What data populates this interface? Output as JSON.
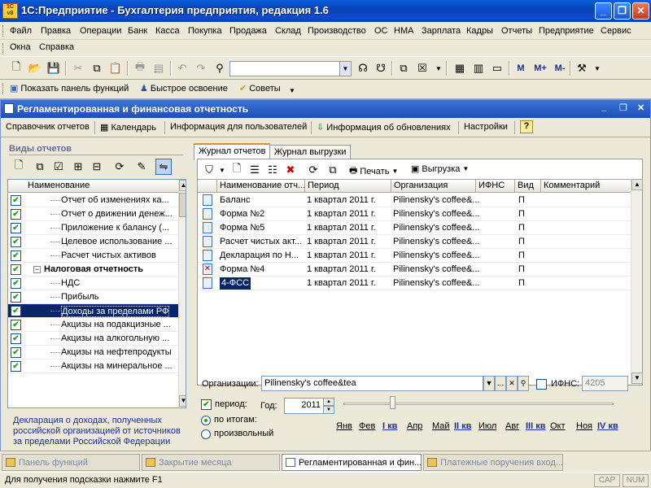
{
  "window": {
    "title": "1С:Предприятие - Бухгалтерия предприятия, редакция 1.6",
    "icon_text": "1С v8"
  },
  "menu": {
    "row1": [
      "Файл",
      "Правка",
      "Операции",
      "Банк",
      "Касса",
      "Покупка",
      "Продажа",
      "Склад",
      "Производство",
      "ОС",
      "НМА",
      "Зарплата",
      "Кадры",
      "Отчеты",
      "Предприятие",
      "Сервис"
    ],
    "row2": [
      "Окна",
      "Справка"
    ]
  },
  "toolbar": {
    "search_value": "",
    "m_buttons": [
      "M",
      "M+",
      "M-"
    ]
  },
  "toolbar2": {
    "functions_panel": "Показать панель функций",
    "quick_start": "Быстрое освоение",
    "tips": "Советы"
  },
  "doc": {
    "title": "Регламентированная и финансовая отчетность",
    "bar": {
      "reference": "Справочник отчетов",
      "calendar": "Календарь",
      "user_info": "Информация для пользователей",
      "updates": "Информация об обновлениях",
      "settings": "Настройки",
      "help": "?"
    }
  },
  "left": {
    "header": "Виды отчетов",
    "column": "Наименование",
    "rows": [
      {
        "label": "Отчет об изменениях ка...",
        "checked": true,
        "group": false
      },
      {
        "label": "Отчет о движении денеж...",
        "checked": true,
        "group": false
      },
      {
        "label": "Приложение к балансу (...",
        "checked": true,
        "group": false
      },
      {
        "label": "Целевое использование ...",
        "checked": true,
        "group": false
      },
      {
        "label": "Расчет чистых активов",
        "checked": true,
        "group": false
      },
      {
        "label": "Налоговая отчетность",
        "checked": true,
        "group": true
      },
      {
        "label": "НДС",
        "checked": true,
        "group": false
      },
      {
        "label": "Прибыль",
        "checked": true,
        "group": false
      },
      {
        "label": "Доходы за пределами РФ",
        "checked": true,
        "group": false,
        "selected": true
      },
      {
        "label": "Акцизы на подакцизные ...",
        "checked": true,
        "group": false
      },
      {
        "label": "Акцизы на алкогольную ...",
        "checked": true,
        "group": false
      },
      {
        "label": "Акцизы на нефтепродукты",
        "checked": true,
        "group": false
      },
      {
        "label": "Акцизы на минеральное ...",
        "checked": true,
        "group": false
      }
    ],
    "note": "Декларация о доходах, полученных российской организацией от источников за пределами Российской Федерации"
  },
  "right": {
    "tabs": [
      "Журнал отчетов",
      "Журнал выгрузки"
    ],
    "print": "Печать",
    "export": "Выгрузка",
    "columns": [
      "Наименование отч...",
      "Период",
      "Организация",
      "ИФНС",
      "Вид",
      "Комментарий"
    ],
    "rows": [
      {
        "name": "Баланс",
        "period": "1 квартал 2011 г.",
        "org": "Pilinensky's coffee&...",
        "ifns": "",
        "kind": "П",
        "comment": ""
      },
      {
        "name": "Форма №2",
        "period": "1 квартал 2011 г.",
        "org": "Pilinensky's coffee&...",
        "ifns": "",
        "kind": "П",
        "comment": ""
      },
      {
        "name": "Форма №5",
        "period": "1 квартал 2011 г.",
        "org": "Pilinensky's coffee&...",
        "ifns": "",
        "kind": "П",
        "comment": ""
      },
      {
        "name": "Расчет чистых акт...",
        "period": "1 квартал 2011 г.",
        "org": "Pilinensky's coffee&...",
        "ifns": "",
        "kind": "П",
        "comment": ""
      },
      {
        "name": "Декларация по Н...",
        "period": "1 квартал 2011 г.",
        "org": "Pilinensky's coffee&...",
        "ifns": "",
        "kind": "П",
        "comment": ""
      },
      {
        "name": "Форма №4",
        "period": "1 квартал 2011 г.",
        "org": "Pilinensky's coffee&...",
        "ifns": "",
        "kind": "П",
        "comment": "",
        "deleted": true
      },
      {
        "name": "4-ФСС",
        "period": "1 квартал 2011 г.",
        "org": "Pilinensky's coffee&...",
        "ifns": "",
        "kind": "П",
        "comment": "",
        "selected": true
      }
    ],
    "org_label": "Организации:",
    "org_value": "Pilinensky's coffee&tea",
    "ifns_label": "ИФНС:",
    "ifns_value": "4205",
    "period_label": "период:",
    "year_label": "Год:",
    "year_value": "2011",
    "radio_totals": "по итогам:",
    "radio_any": "произвольный",
    "periods": [
      {
        "label": "Янв",
        "bold": false
      },
      {
        "label": "Фев",
        "bold": false
      },
      {
        "label": "I кв",
        "bold": true,
        "active": true
      },
      {
        "label": "Апр",
        "bold": false
      },
      {
        "label": "Май",
        "bold": false
      },
      {
        "label": "II кв",
        "bold": true
      },
      {
        "label": "Июл",
        "bold": false
      },
      {
        "label": "Авг",
        "bold": false
      },
      {
        "label": "III кв",
        "bold": true
      },
      {
        "label": "Окт",
        "bold": false
      },
      {
        "label": "Ноя",
        "bold": false
      },
      {
        "label": "IV кв",
        "bold": true
      }
    ]
  },
  "taskbar": [
    "Панель функций",
    "Закрытие месяца",
    "Регламентированная и фин...",
    "Платежные поручения вход..."
  ],
  "status": {
    "hint": "Для получения подсказки нажмите F1",
    "cap": "CAP",
    "num": "NUM"
  }
}
